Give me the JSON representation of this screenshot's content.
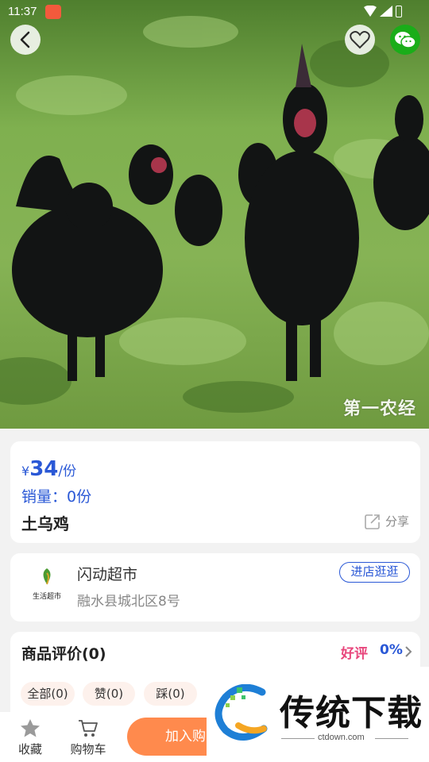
{
  "status_bar": {
    "time": "11:37"
  },
  "hero": {
    "watermark": "第一农经"
  },
  "product": {
    "currency": "¥",
    "price": "34",
    "unit": "/份",
    "sales": "销量：0份",
    "name": "土乌鸡",
    "share_label": "分享"
  },
  "store": {
    "logo_text": "生活超市",
    "name": "闪动超市",
    "address": "融水县城北区8号",
    "visit_label": "进店逛逛"
  },
  "reviews": {
    "title": "商品评价(0)",
    "good_label": "好评",
    "good_rate": "0%",
    "filters": [
      "全部(0)",
      "赞(0)",
      "踩(0)"
    ]
  },
  "bottom_bar": {
    "favorite_label": "收藏",
    "cart_label": "购物车",
    "add_to_cart_label": "加入购"
  },
  "promo": {
    "title": "传统下载",
    "url": "ctdown.com"
  },
  "colors": {
    "accent_blue": "#2a58d6",
    "good_pink": "#e8467c",
    "cart_orange": "#ff8a4d",
    "wechat_green": "#1aad19"
  }
}
